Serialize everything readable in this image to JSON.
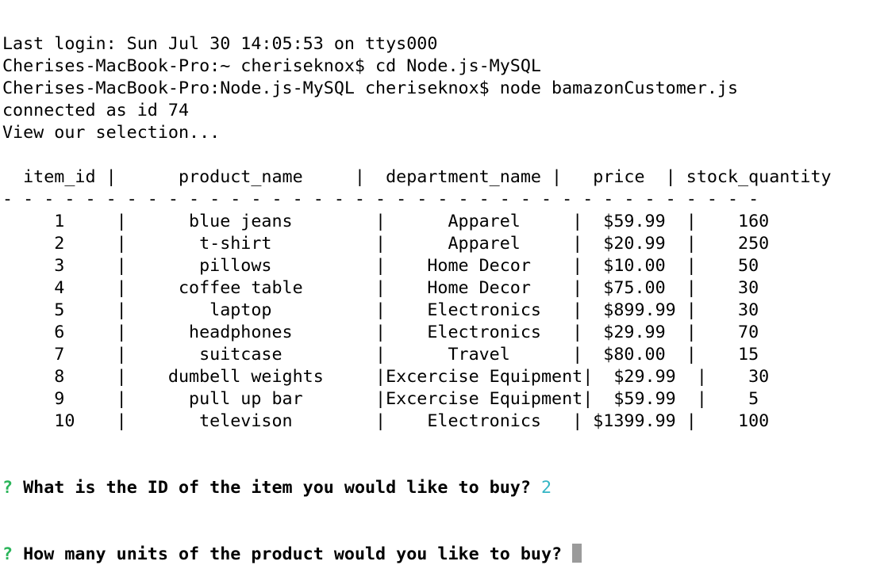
{
  "terminal": {
    "lines": [
      "Last login: Sun Jul 30 14:05:53 on ttys000",
      "Cherises-MacBook-Pro:~ cheriseknox$ cd Node.js-MySQL",
      "Cherises-MacBook-Pro:Node.js-MySQL cheriseknox$ node bamazonCustomer.js",
      "connected as id 74",
      "View our selection...",
      "",
      "  item_id |      product_name     |  department_name |   price  | stock_quantity",
      "- - - - - - - - - - - - - - - - - - - - - - - - - - - - - - - - - - - - -",
      "     1     |      blue jeans        |      Apparel     |  $59.99  |    160",
      "     2     |       t-shirt          |      Apparel     |  $20.99  |    250",
      "     3     |       pillows          |    Home Decor    |  $10.00  |    50",
      "     4     |     coffee table       |    Home Decor    |  $75.00  |    30",
      "     5     |        laptop          |    Electronics   |  $899.99 |    30",
      "     6     |      headphones        |    Electronics   |  $29.99  |    70",
      "     7     |       suitcase         |      Travel      |  $80.00  |    15",
      "     8     |    dumbell weights     |Excercise Equipment|  $29.99  |    30",
      "     9     |      pull up bar       |Excercise Equipment|  $59.99  |    5",
      "     10    |       televison        |    Electronics   | $1399.99 |    100"
    ],
    "prompt1": {
      "mark": "?",
      "question": "What is the ID of the item you would like to buy?",
      "answer": "2"
    },
    "prompt2": {
      "mark": "?",
      "question": "How many units of the product would you like to buy?"
    },
    "colors": {
      "prompt_mark": "#2bb55a",
      "answer": "#33b5c4",
      "cursor": "#9b9b9b"
    }
  }
}
